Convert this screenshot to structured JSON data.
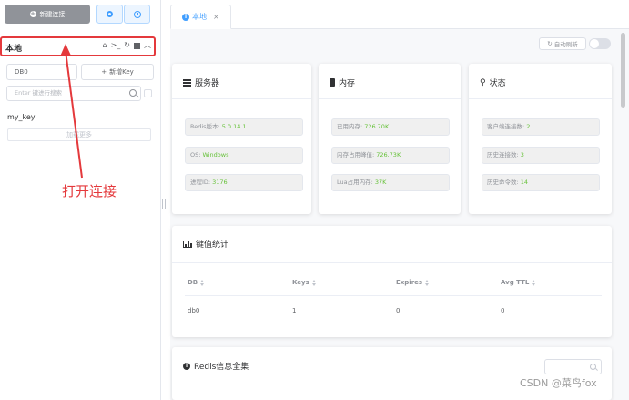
{
  "toolbar": {
    "new_connection_label": "新建连接"
  },
  "connection": {
    "name": "本地"
  },
  "db_selector": {
    "selected": "DB0"
  },
  "add_key_label": "新增Key",
  "search": {
    "placeholder": "Enter 键进行搜索"
  },
  "keys": [
    "my_key"
  ],
  "load_more_label": "加载更多",
  "annotation": {
    "text": "打开连接",
    "color": "#e4393c"
  },
  "tab": {
    "label": "本地",
    "close": "×"
  },
  "auto_refresh_label": "自动刷新",
  "cards": {
    "server": {
      "title": "服务器",
      "items": [
        {
          "label": "Redis版本:",
          "value": "5.0.14.1"
        },
        {
          "label": "OS:",
          "value": "Windows"
        },
        {
          "label": "进程ID:",
          "value": "3176"
        }
      ]
    },
    "memory": {
      "title": "内存",
      "items": [
        {
          "label": "已用内存:",
          "value": "726.70K"
        },
        {
          "label": "内存占用峰值:",
          "value": "726.73K"
        },
        {
          "label": "Lua占用内存:",
          "value": "37K"
        }
      ]
    },
    "status": {
      "title": "状态",
      "items": [
        {
          "label": "客户端连接数:",
          "value": "2"
        },
        {
          "label": "历史连接数:",
          "value": "3"
        },
        {
          "label": "历史命令数:",
          "value": "14"
        }
      ]
    }
  },
  "key_stats": {
    "title": "键值统计",
    "columns": [
      "DB",
      "Keys",
      "Expires",
      "Avg TTL"
    ],
    "rows": [
      [
        "db0",
        "1",
        "0",
        "0"
      ]
    ]
  },
  "redis_info": {
    "title": "Redis信息全集"
  },
  "watermark": "CSDN @菜鸟fox",
  "colors": {
    "accent": "#409eff",
    "value_green": "#67c23a",
    "annotation_red": "#e4393c"
  }
}
